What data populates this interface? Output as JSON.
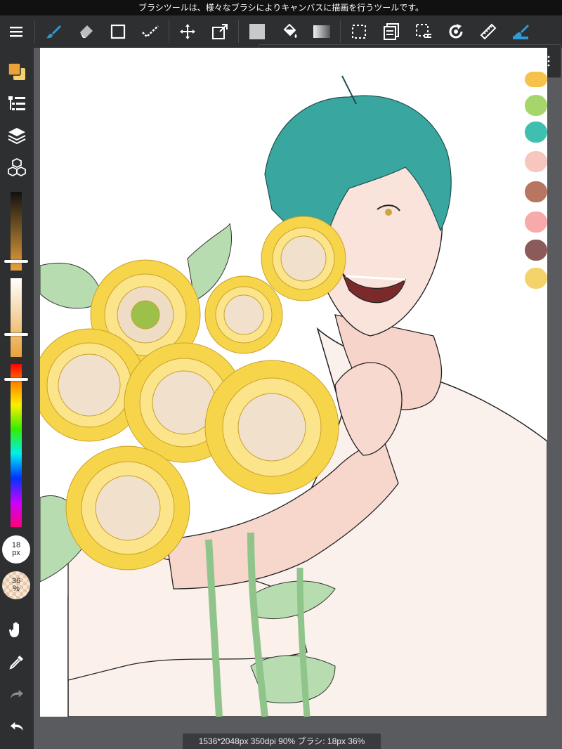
{
  "info_bar": {
    "text": "ブラシツールは、様々なブラシによりキャンバスに描画を行うツールです。"
  },
  "toolbar": {
    "items": [
      "menu-icon",
      "brush-icon",
      "eraser-icon",
      "rectangle-icon",
      "select-check-icon",
      "move-icon",
      "transform-icon",
      "fill-color-icon",
      "bucket-icon",
      "gradient-icon",
      "selection-icon",
      "layer-list-icon",
      "selection-edit-icon",
      "rotate-icon",
      "ruler-icon",
      "highlight-brush-icon"
    ],
    "accent": "#2e9bd6"
  },
  "subbar": {
    "items": [
      "undo-icon",
      "redo-icon",
      "brush-snap-icon",
      "eyedropper-icon",
      "save-icon",
      "flip-icon",
      "clear-icon",
      "share-icon",
      "more-grid-icon"
    ]
  },
  "sidebar": {
    "brush_size": {
      "value": "18",
      "unit": "px"
    },
    "opacity": {
      "value": "36",
      "unit": "%"
    },
    "color_swatch": {
      "primary": "#e8a23a",
      "secondary": "#f3d36b"
    }
  },
  "palette": {
    "colors": [
      "#f7c24a",
      "#a6d66b",
      "#3fbfb0",
      "#f7c6bf",
      "#b87561",
      "#f8a9a9",
      "#8b5a5a",
      "#f5d36b"
    ]
  },
  "status": {
    "text": "1536*2048px 350dpi 90% ブラシ: 18px 36%"
  }
}
